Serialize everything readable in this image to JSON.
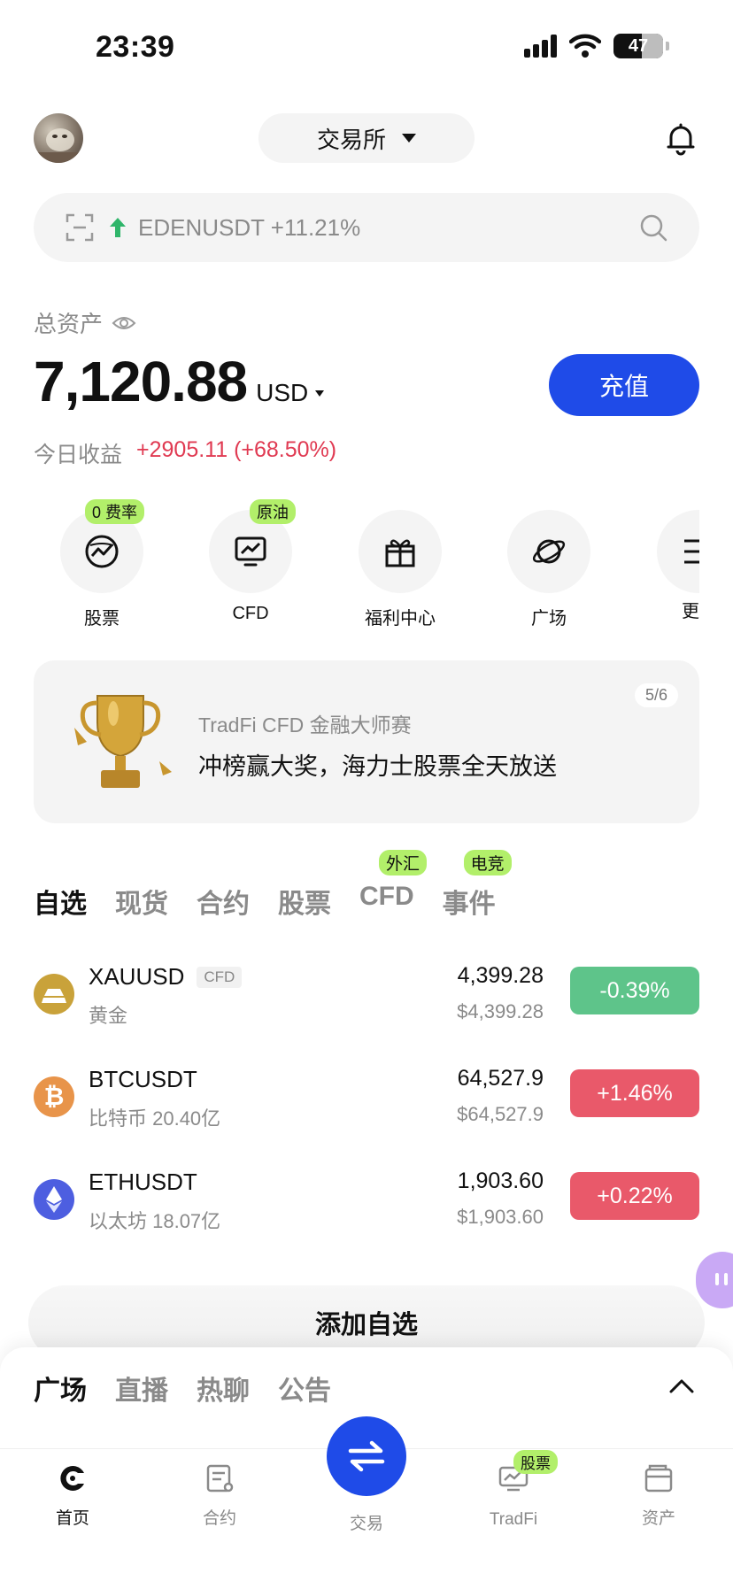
{
  "status_bar": {
    "time": "23:39",
    "battery": "47"
  },
  "header": {
    "exchange_label": "交易所"
  },
  "search": {
    "ticker_text": "EDENUSDT +11.21%"
  },
  "assets": {
    "label": "总资产",
    "value": "7,120.88",
    "currency": "USD",
    "deposit_label": "充值",
    "pnl_label": "今日收益",
    "pnl_value": "+2905.11 (+68.50%)"
  },
  "quick_actions": [
    {
      "label": "股票",
      "tag": "0 费率"
    },
    {
      "label": "CFD",
      "tag": "原油"
    },
    {
      "label": "福利中心",
      "tag": ""
    },
    {
      "label": "广场",
      "tag": ""
    },
    {
      "label": "更",
      "tag": ""
    }
  ],
  "banner": {
    "page_indicator": "5/6",
    "subtitle": "TradFi CFD 金融大师赛",
    "title": "冲榜赢大奖，海力士股票全天放送"
  },
  "market_tabs": [
    {
      "label": "自选",
      "tag": ""
    },
    {
      "label": "现货",
      "tag": ""
    },
    {
      "label": "合约",
      "tag": ""
    },
    {
      "label": "股票",
      "tag": ""
    },
    {
      "label": "CFD",
      "tag": "外汇"
    },
    {
      "label": "事件",
      "tag": "电竞"
    }
  ],
  "market_rows": [
    {
      "symbol": "XAUUSD",
      "badge": "CFD",
      "name": "黄金",
      "price": "4,399.28",
      "price_usd": "$4,399.28",
      "change": "-0.39%",
      "change_color": "#5ec48a",
      "coin_color": "#c9a23a"
    },
    {
      "symbol": "BTCUSDT",
      "badge": "",
      "name": "比特币 20.40亿",
      "price": "64,527.9",
      "price_usd": "$64,527.9",
      "change": "+1.46%",
      "change_color": "#e9596a",
      "coin_color": "#e8944a"
    },
    {
      "symbol": "ETHUSDT",
      "badge": "",
      "name": "以太坊 18.07亿",
      "price": "1,903.60",
      "price_usd": "$1,903.60",
      "change": "+0.22%",
      "change_color": "#e9596a",
      "coin_color": "#4d5ee0"
    }
  ],
  "add_favorite_label": "添加自选",
  "sheet_tabs": [
    "广场",
    "直播",
    "热聊",
    "公告"
  ],
  "bottom_nav": [
    {
      "label": "首页",
      "icon": "home-icon"
    },
    {
      "label": "合约",
      "icon": "contract-icon"
    },
    {
      "label": "交易",
      "icon": "swap-icon"
    },
    {
      "label": "TradFi",
      "icon": "tradfi-icon",
      "tag": "股票"
    },
    {
      "label": "资产",
      "icon": "wallet-icon"
    }
  ],
  "colors": {
    "accent": "#1f4be8",
    "up": "#e9596a",
    "down": "#5ec48a",
    "tag": "#b2ef6a"
  }
}
